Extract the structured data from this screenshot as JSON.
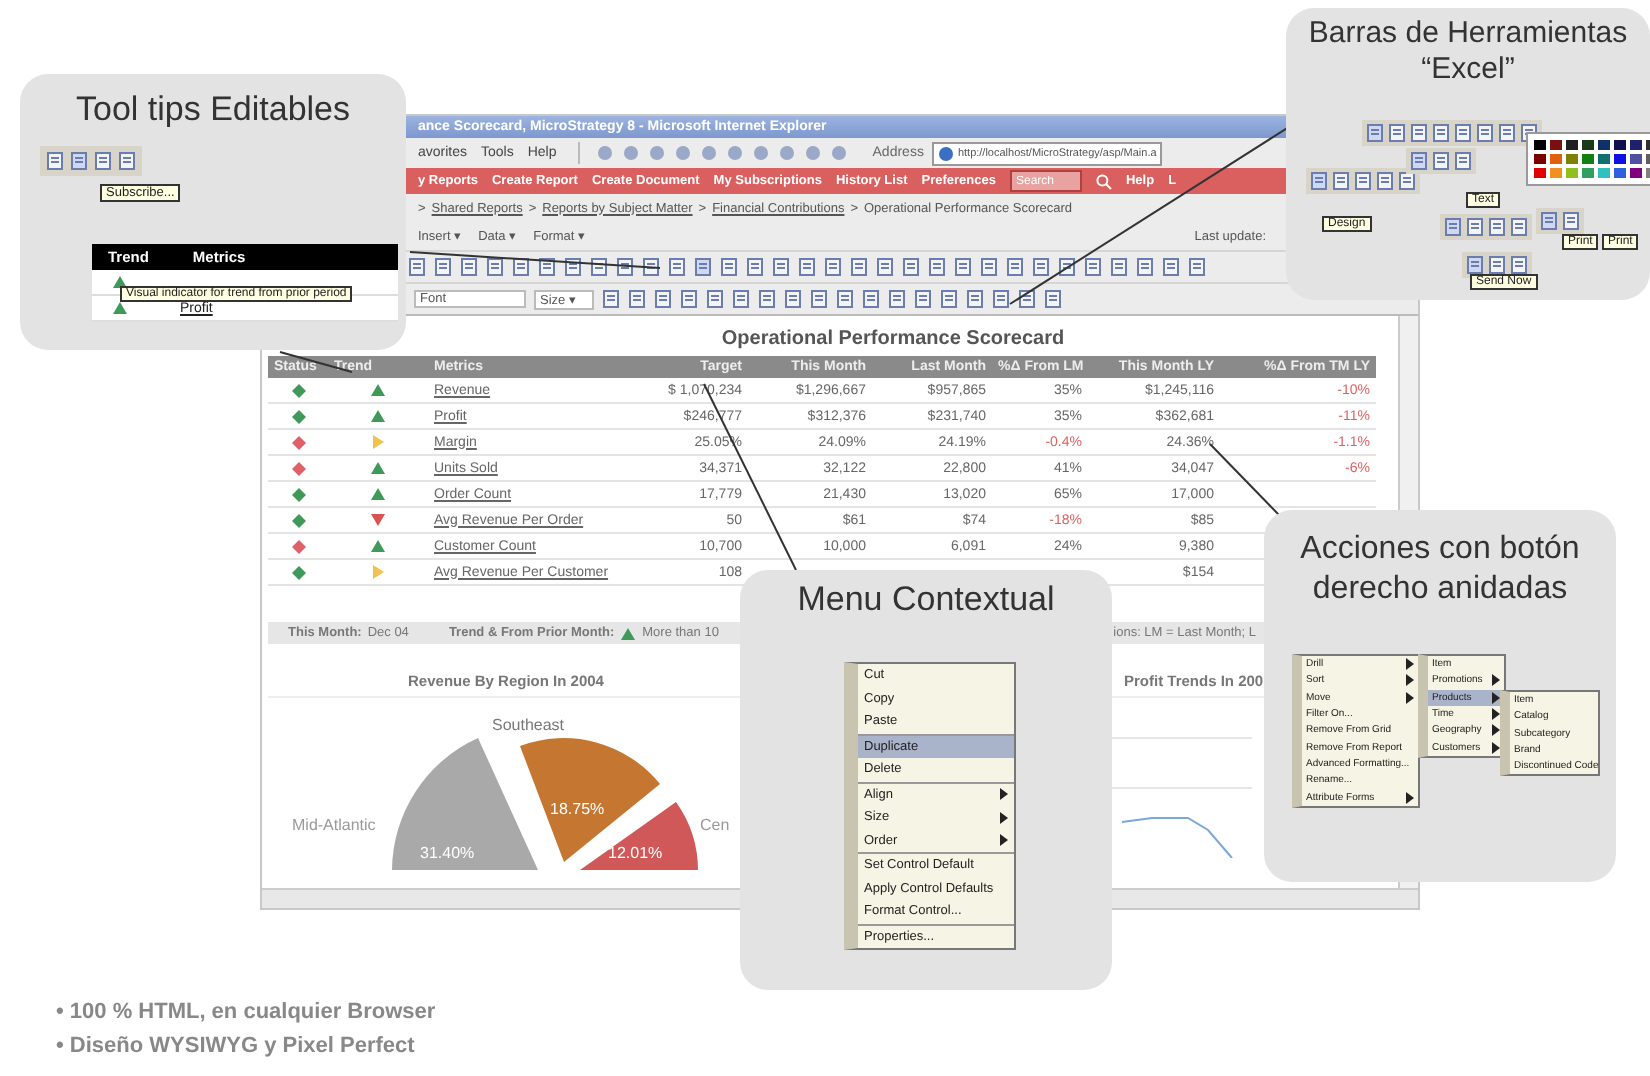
{
  "browser": {
    "title": "ance Scorecard, MicroStrategy 8 - Microsoft Internet Explorer",
    "menu": [
      "avorites",
      "Tools",
      "Help"
    ],
    "address_label": "Address",
    "address": "http://localhost/MicroStrategy/asp/Main.a",
    "nav": [
      "y Reports",
      "Create Report",
      "Create Document",
      "My Subscriptions",
      "History List",
      "Preferences"
    ],
    "search": {
      "placeholder": "Search"
    },
    "nav_right": [
      "Help",
      "L"
    ],
    "breadcrumb": [
      {
        "sep": ">",
        "label": "Shared Reports",
        "link": true
      },
      {
        "sep": ">",
        "label": "Reports by Subject Matter",
        "link": true
      },
      {
        "sep": ">",
        "label": "Financial Contributions",
        "link": true
      },
      {
        "sep": ">",
        "label": "Operational Performance Scorecard",
        "link": false
      }
    ],
    "edit_menus": [
      "Insert ▾",
      "Data ▾",
      "Format ▾"
    ],
    "last_update": "Last update:",
    "font_field": "Font",
    "size_field": "Size ▾"
  },
  "report": {
    "title": "Operational Performance Scorecard",
    "columns": [
      "Status",
      "Trend",
      "Metrics",
      "Target",
      "This Month",
      "Last Month",
      "%Δ From LM",
      "This Month LY",
      "%Δ From TM LY"
    ],
    "rows": [
      {
        "status": {
          "color": "#3f9a5a"
        },
        "trend": {
          "kind": "up"
        },
        "metric": "Revenue",
        "target": "$ 1,070,234",
        "this_month": "$1,296,667",
        "last_month": "$957,865",
        "change_lm": {
          "text": "35%",
          "negative": false
        },
        "this_month_ly": "$1,245,116",
        "change_ly": {
          "text": "-10%",
          "negative": true
        }
      },
      {
        "status": {
          "color": "#3f9a5a"
        },
        "trend": {
          "kind": "up"
        },
        "metric": "Profit",
        "target": "$246,777",
        "this_month": "$312,376",
        "last_month": "$231,740",
        "change_lm": {
          "text": "35%",
          "negative": false
        },
        "this_month_ly": "$362,681",
        "change_ly": {
          "text": "-11%",
          "negative": true
        }
      },
      {
        "status": {
          "color": "#e0606a"
        },
        "trend": {
          "kind": "flat"
        },
        "metric": "Margin",
        "target": "25.05%",
        "this_month": "24.09%",
        "last_month": "24.19%",
        "change_lm": {
          "text": "-0.4%",
          "negative": true
        },
        "this_month_ly": "24.36%",
        "change_ly": {
          "text": "-1.1%",
          "negative": true
        }
      },
      {
        "status": {
          "color": "#e0606a"
        },
        "trend": {
          "kind": "up"
        },
        "metric": "Units Sold",
        "target": "34,371",
        "this_month": "32,122",
        "last_month": "22,800",
        "change_lm": {
          "text": "41%",
          "negative": false
        },
        "this_month_ly": "34,047",
        "change_ly": {
          "text": "-6%",
          "negative": true
        }
      },
      {
        "status": {
          "color": "#3f9a5a"
        },
        "trend": {
          "kind": "up"
        },
        "metric": "Order Count",
        "target": "17,779",
        "this_month": "21,430",
        "last_month": "13,020",
        "change_lm": {
          "text": "65%",
          "negative": false
        },
        "this_month_ly": "17,000",
        "change_ly": null
      },
      {
        "status": {
          "color": "#3f9a5a"
        },
        "trend": {
          "kind": "down"
        },
        "metric": "Avg Revenue Per Order",
        "target": "50",
        "this_month": "$61",
        "last_month": "$74",
        "change_lm": {
          "text": "-18%",
          "negative": true
        },
        "this_month_ly": "$85",
        "change_ly": null
      },
      {
        "status": {
          "color": "#e0606a"
        },
        "trend": {
          "kind": "up"
        },
        "metric": "Customer Count",
        "target": "10,700",
        "this_month": "10,000",
        "last_month": "6,091",
        "change_lm": {
          "text": "24%",
          "negative": false
        },
        "this_month_ly": "9,380",
        "change_ly": null
      },
      {
        "status": {
          "color": "#3f9a5a"
        },
        "trend": {
          "kind": "flat"
        },
        "metric": "Avg Revenue Per Customer",
        "target": "108",
        "this_month": null,
        "last_month": null,
        "change_lm": null,
        "this_month_ly": "$154",
        "change_ly": null
      }
    ],
    "legend": {
      "month_label": "This Month:",
      "month_value": "Dec 04",
      "trend_label": "Trend & From Prior Month:",
      "trend_item": "More than 10",
      "abbreviations": "ions: LM = Last Month; L"
    },
    "pie_title": "Revenue By Region In 2004",
    "pie_labels": [
      "Southeast",
      "Mid-Atlantic",
      "Cen"
    ],
    "pie_values": [
      "31.40%",
      "18.75%",
      "12.01%"
    ],
    "line_title": "Profit Trends In 200"
  },
  "callouts": [
    {
      "kind": "tooltips",
      "title": "Tool tips Editables",
      "button_tip": "Subscribe...",
      "columns": [
        "Trend",
        "Metrics"
      ],
      "row_tip": "Visual indicator for trend from prior period",
      "metric": "Profit"
    },
    {
      "kind": "toolbars",
      "title": "Barras de Herramientas “Excel”",
      "tips": [
        "Text",
        "Design",
        "Send Now",
        "Print",
        "Print"
      ]
    },
    {
      "kind": "context",
      "title": "Menu Contextual",
      "items": [
        {
          "label": "Cut",
          "submenu": false,
          "selected": false,
          "divider": false
        },
        {
          "label": "Copy",
          "submenu": false,
          "selected": false,
          "divider": false
        },
        {
          "label": "Paste",
          "submenu": false,
          "selected": false,
          "divider": false
        },
        {
          "label": "Duplicate",
          "submenu": false,
          "selected": true,
          "divider": true
        },
        {
          "label": "Delete",
          "submenu": false,
          "selected": false,
          "divider": false
        },
        {
          "label": "Align",
          "submenu": true,
          "selected": false,
          "divider": true
        },
        {
          "label": "Size",
          "submenu": true,
          "selected": false,
          "divider": false
        },
        {
          "label": "Order",
          "submenu": true,
          "selected": false,
          "divider": false
        },
        {
          "label": "Set Control Default",
          "submenu": false,
          "selected": false,
          "divider": true
        },
        {
          "label": "Apply Control Defaults",
          "submenu": false,
          "selected": false,
          "divider": false
        },
        {
          "label": "Format Control...",
          "submenu": false,
          "selected": false,
          "divider": false
        },
        {
          "label": "Properties...",
          "submenu": false,
          "selected": false,
          "divider": true
        }
      ]
    },
    {
      "kind": "nested",
      "title": "Acciones con botón derecho anidadas",
      "menus": [
        [
          {
            "label": "Drill",
            "submenu": true,
            "selected": false
          },
          {
            "label": "Sort",
            "submenu": true,
            "selected": false
          },
          {
            "label": "Move",
            "submenu": true,
            "selected": false
          },
          {
            "label": "Filter On...",
            "submenu": false,
            "selected": false
          },
          {
            "label": "Remove From Grid",
            "submenu": false,
            "selected": false
          },
          {
            "label": "Remove From Report",
            "submenu": false,
            "selected": false
          },
          {
            "label": "Advanced Formatting...",
            "submenu": false,
            "selected": false
          },
          {
            "label": "Rename...",
            "submenu": false,
            "selected": false
          },
          {
            "label": "Attribute Forms",
            "submenu": true,
            "selected": false
          }
        ],
        [
          {
            "label": "Item",
            "submenu": false,
            "selected": false
          },
          {
            "label": "Promotions",
            "submenu": true,
            "selected": false
          },
          {
            "label": "Products",
            "submenu": true,
            "selected": true
          },
          {
            "label": "Time",
            "submenu": true,
            "selected": false
          },
          {
            "label": "Geography",
            "submenu": true,
            "selected": false
          },
          {
            "label": "Customers",
            "submenu": true,
            "selected": false
          }
        ],
        [
          {
            "label": "Item",
            "submenu": false,
            "selected": false
          },
          {
            "label": "Catalog",
            "submenu": false,
            "selected": false
          },
          {
            "label": "Subcategory",
            "submenu": false,
            "selected": false
          },
          {
            "label": "Brand",
            "submenu": false,
            "selected": false
          },
          {
            "label": "Discontinued Code",
            "submenu": false,
            "selected": false
          }
        ]
      ]
    }
  ],
  "bullets": [
    "• 100 % HTML, en cualquier Browser",
    "• Diseño WYSIWYG y Pixel Perfect"
  ]
}
